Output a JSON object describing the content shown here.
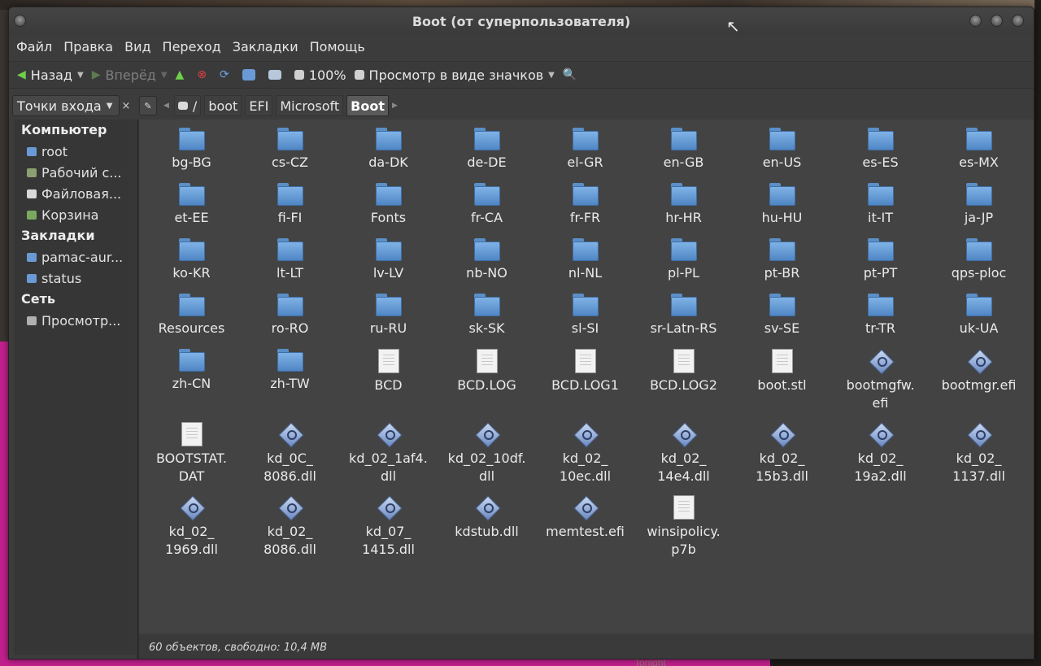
{
  "window": {
    "title": "Boot (от суперпользователя)"
  },
  "menu": [
    "Файл",
    "Правка",
    "Вид",
    "Переход",
    "Закладки",
    "Помощь"
  ],
  "toolbar": {
    "back": "Назад",
    "forward": "Вперёд",
    "zoom": "100%",
    "view_mode": "Просмотр в виде значков"
  },
  "places": {
    "selector": "Точки входа",
    "close": "×"
  },
  "breadcrumbs": [
    "/",
    "boot",
    "EFI",
    "Microsoft",
    "Boot"
  ],
  "sidebar": {
    "sections": [
      {
        "title": "Компьютер",
        "items": [
          {
            "label": "root",
            "icon": "home-folder-icon",
            "color": "#6a9ad6"
          },
          {
            "label": "Рабочий с...",
            "icon": "desktop-icon",
            "color": "#8aa070"
          },
          {
            "label": "Файловая...",
            "icon": "drive-icon",
            "color": "#d8d8d8"
          },
          {
            "label": "Корзина",
            "icon": "trash-icon",
            "color": "#7aa860"
          }
        ]
      },
      {
        "title": "Закладки",
        "items": [
          {
            "label": "pamac-aur...",
            "icon": "folder-icon",
            "color": "#6a9ad6"
          },
          {
            "label": "status",
            "icon": "folder-icon",
            "color": "#6a9ad6"
          }
        ]
      },
      {
        "title": "Сеть",
        "items": [
          {
            "label": "Просмотр...",
            "icon": "network-icon",
            "color": "#b0b0b0"
          }
        ]
      }
    ]
  },
  "files": [
    {
      "name": "bg-BG",
      "type": "folder"
    },
    {
      "name": "cs-CZ",
      "type": "folder"
    },
    {
      "name": "da-DK",
      "type": "folder"
    },
    {
      "name": "de-DE",
      "type": "folder"
    },
    {
      "name": "el-GR",
      "type": "folder"
    },
    {
      "name": "en-GB",
      "type": "folder"
    },
    {
      "name": "en-US",
      "type": "folder"
    },
    {
      "name": "es-ES",
      "type": "folder"
    },
    {
      "name": "es-MX",
      "type": "folder"
    },
    {
      "name": "et-EE",
      "type": "folder"
    },
    {
      "name": "fi-FI",
      "type": "folder"
    },
    {
      "name": "Fonts",
      "type": "folder"
    },
    {
      "name": "fr-CA",
      "type": "folder"
    },
    {
      "name": "fr-FR",
      "type": "folder"
    },
    {
      "name": "hr-HR",
      "type": "folder"
    },
    {
      "name": "hu-HU",
      "type": "folder"
    },
    {
      "name": "it-IT",
      "type": "folder"
    },
    {
      "name": "ja-JP",
      "type": "folder"
    },
    {
      "name": "ko-KR",
      "type": "folder"
    },
    {
      "name": "lt-LT",
      "type": "folder"
    },
    {
      "name": "lv-LV",
      "type": "folder"
    },
    {
      "name": "nb-NO",
      "type": "folder"
    },
    {
      "name": "nl-NL",
      "type": "folder"
    },
    {
      "name": "pl-PL",
      "type": "folder"
    },
    {
      "name": "pt-BR",
      "type": "folder"
    },
    {
      "name": "pt-PT",
      "type": "folder"
    },
    {
      "name": "qps-ploc",
      "type": "folder"
    },
    {
      "name": "Resources",
      "type": "folder"
    },
    {
      "name": "ro-RO",
      "type": "folder"
    },
    {
      "name": "ru-RU",
      "type": "folder"
    },
    {
      "name": "sk-SK",
      "type": "folder"
    },
    {
      "name": "sl-SI",
      "type": "folder"
    },
    {
      "name": "sr-Latn-RS",
      "type": "folder"
    },
    {
      "name": "sv-SE",
      "type": "folder"
    },
    {
      "name": "tr-TR",
      "type": "folder"
    },
    {
      "name": "uk-UA",
      "type": "folder"
    },
    {
      "name": "zh-CN",
      "type": "folder"
    },
    {
      "name": "zh-TW",
      "type": "folder"
    },
    {
      "name": "BCD",
      "type": "doc"
    },
    {
      "name": "BCD.LOG",
      "type": "doc"
    },
    {
      "name": "BCD.LOG1",
      "type": "doc"
    },
    {
      "name": "BCD.LOG2",
      "type": "doc"
    },
    {
      "name": "boot.stl",
      "type": "doc"
    },
    {
      "name": "bootmgfw.\nefi",
      "type": "exe"
    },
    {
      "name": "bootmgr.efi",
      "type": "exe"
    },
    {
      "name": "BOOTSTAT.\nDAT",
      "type": "doc"
    },
    {
      "name": "kd_0C_\n8086.dll",
      "type": "exe"
    },
    {
      "name": "kd_02_1af4.\ndll",
      "type": "exe"
    },
    {
      "name": "kd_02_10df.\ndll",
      "type": "exe"
    },
    {
      "name": "kd_02_\n10ec.dll",
      "type": "exe"
    },
    {
      "name": "kd_02_\n14e4.dll",
      "type": "exe"
    },
    {
      "name": "kd_02_\n15b3.dll",
      "type": "exe"
    },
    {
      "name": "kd_02_\n19a2.dll",
      "type": "exe"
    },
    {
      "name": "kd_02_\n1137.dll",
      "type": "exe"
    },
    {
      "name": "kd_02_\n1969.dll",
      "type": "exe"
    },
    {
      "name": "kd_02_\n8086.dll",
      "type": "exe"
    },
    {
      "name": "kd_07_\n1415.dll",
      "type": "exe"
    },
    {
      "name": "kdstub.dll",
      "type": "exe"
    },
    {
      "name": "memtest.efi",
      "type": "exe"
    },
    {
      "name": "winsipolicy.\np7b",
      "type": "doc"
    }
  ],
  "status": "60 объектов, свободно: 10,4 MB",
  "desktop": {
    "tonight": "Tonight"
  },
  "colors": {
    "folder": "#5b8fc8",
    "desktop_accent": "#c0208c"
  }
}
